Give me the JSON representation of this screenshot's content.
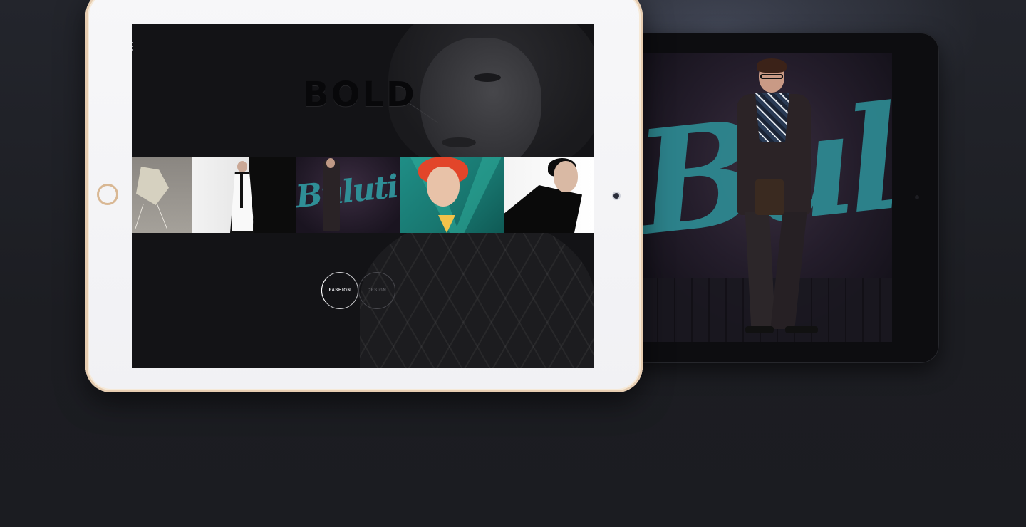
{
  "hero": {
    "headline": "BOLD"
  },
  "thumbnails": [
    {
      "name": "chair"
    },
    {
      "name": "white-dress"
    },
    {
      "name": "buluti",
      "script_text": "Buluti"
    },
    {
      "name": "v-portrait",
      "letter": "V"
    },
    {
      "name": "latex-coat"
    }
  ],
  "categories": {
    "fashion_label": "FASHION",
    "design_label": "DESIGN",
    "selected": "FASHION"
  },
  "back_device": {
    "script_text": "Bulu"
  },
  "colors": {
    "page_background": "#1c1d22",
    "screen_background": "#131316",
    "accent_teal": "#2f8e96",
    "device_gold": "#e7cdb1"
  }
}
